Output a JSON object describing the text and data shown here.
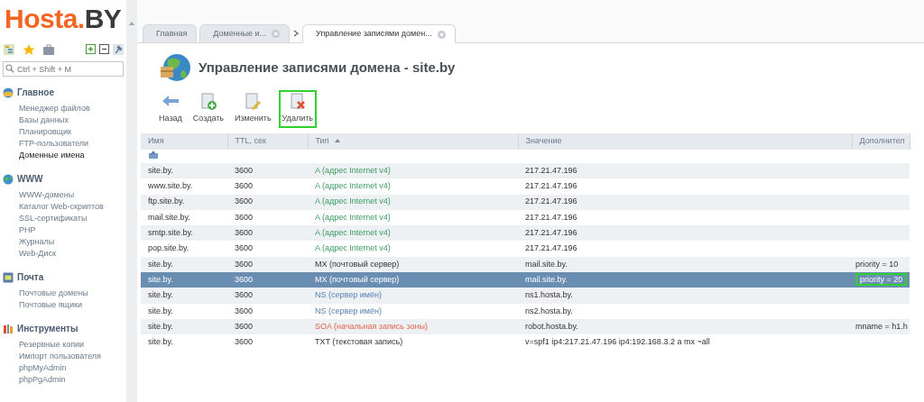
{
  "logo": {
    "brand": "Hosta.",
    "suffix": "BY"
  },
  "sidebar": {
    "search": {
      "placeholder": "Ctrl + Shift + M"
    },
    "sections": [
      {
        "title": "Главное",
        "items": [
          {
            "label": "Менеджер файлов",
            "selected": false
          },
          {
            "label": "Базы данных",
            "selected": false
          },
          {
            "label": "Планировщик",
            "selected": false
          },
          {
            "label": "FTP-пользователи",
            "selected": false
          },
          {
            "label": "Доменные имена",
            "selected": true
          }
        ]
      },
      {
        "title": "WWW",
        "items": [
          {
            "label": "WWW-домены",
            "selected": false
          },
          {
            "label": "Каталог Web-скриптов",
            "selected": false
          },
          {
            "label": "SSL-сертификаты",
            "selected": false
          },
          {
            "label": "PHP",
            "selected": false
          },
          {
            "label": "Журналы",
            "selected": false
          },
          {
            "label": "Web-Диск",
            "selected": false
          }
        ]
      },
      {
        "title": "Почта",
        "items": [
          {
            "label": "Почтовые домены",
            "selected": false
          },
          {
            "label": "Почтовые ящики",
            "selected": false
          }
        ]
      },
      {
        "title": "Инструменты",
        "items": [
          {
            "label": "Резервные копии",
            "selected": false
          },
          {
            "label": "Импорт пользователя",
            "selected": false
          },
          {
            "label": "phpMyAdmin",
            "selected": false
          },
          {
            "label": "phpPgAdmin",
            "selected": false
          }
        ]
      }
    ]
  },
  "tabs": [
    {
      "label": "Главная",
      "closable": false,
      "selected": false
    },
    {
      "label": "Доменные и...",
      "closable": true,
      "selected": false
    },
    {
      "label": "Управление записями домен...",
      "closable": true,
      "selected": true
    }
  ],
  "page_title": "Управление записями домена - site.by",
  "toolbar": [
    {
      "label": "Назад",
      "highlighted": false
    },
    {
      "label": "Создать",
      "highlighted": false
    },
    {
      "label": "Изменить",
      "highlighted": false
    },
    {
      "label": "Удалить",
      "highlighted": true
    }
  ],
  "table": {
    "columns": [
      {
        "label": "Имя",
        "sorted": false
      },
      {
        "label": "TTL, сек",
        "sorted": false
      },
      {
        "label": "Тип",
        "sorted": true
      },
      {
        "label": "Значение",
        "sorted": false
      },
      {
        "label": "Дополнител",
        "sorted": false
      }
    ],
    "rows": [
      {
        "name": "site.by.",
        "ttl": "3600",
        "type": "A (адрес Internet v4)",
        "kind": "a",
        "value": "217.21.47.196",
        "selected": false
      },
      {
        "name": "www.site.by.",
        "ttl": "3600",
        "type": "A (адрес Internet v4)",
        "kind": "a",
        "value": "217.21.47.196",
        "selected": false
      },
      {
        "name": "ftp.site.by.",
        "ttl": "3600",
        "type": "A (адрес Internet v4)",
        "kind": "a",
        "value": "217.21.47.196",
        "selected": false
      },
      {
        "name": "mail.site.by.",
        "ttl": "3600",
        "type": "A (адрес Internet v4)",
        "kind": "a",
        "value": "217.21.47.196",
        "selected": false
      },
      {
        "name": "smtp.site.by.",
        "ttl": "3600",
        "type": "A (адрес Internet v4)",
        "kind": "a",
        "value": "217.21.47.196",
        "selected": false
      },
      {
        "name": "pop.site.by.",
        "ttl": "3600",
        "type": "A (адрес Internet v4)",
        "kind": "a",
        "value": "217.21.47.196",
        "selected": false
      },
      {
        "name": "site.by.",
        "ttl": "3600",
        "type": "MX (почтовый сервер)",
        "kind": "mx",
        "value": "mail.site.by.",
        "extra": "priority = 10",
        "selected": false
      },
      {
        "name": "site.by.",
        "ttl": "3600",
        "type": "MX (почтовый сервер)",
        "kind": "mx",
        "value": "mail.site.by.",
        "extra": "priority = 20",
        "extra_highlighted": true,
        "selected": true
      },
      {
        "name": "site.by.",
        "ttl": "3600",
        "type": "NS (сервер имён)",
        "kind": "ns",
        "value": "ns1.hosta.by.",
        "selected": false
      },
      {
        "name": "site.by.",
        "ttl": "3600",
        "type": "NS (сервер имён)",
        "kind": "ns",
        "value": "ns2.hosta.by.",
        "selected": false
      },
      {
        "name": "site.by.",
        "ttl": "3600",
        "type": "SOA (начальная запись зоны)",
        "kind": "soa",
        "value": "robot.hosta.by.",
        "extra": "mname = h1.h",
        "selected": false
      },
      {
        "name": "site.by.",
        "ttl": "3600",
        "type": "TXT (текстовая запись)",
        "kind": "txt",
        "value": "v=spf1 ip4:217.21.47.196 ip4:192.168.3.2 a mx ~all",
        "selected": false
      }
    ]
  }
}
